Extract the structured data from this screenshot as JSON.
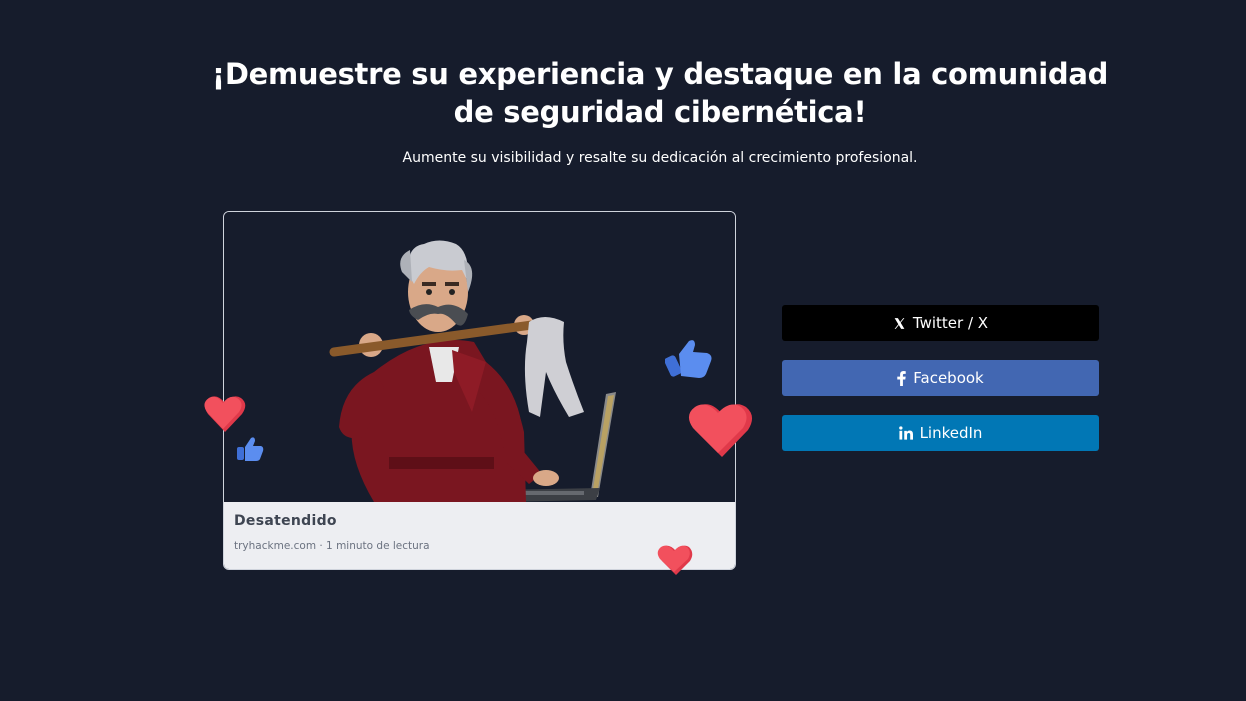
{
  "hero": {
    "headline": "¡Demuestre su experiencia y destaque en la comunidad de seguridad cibernética!",
    "subtitle": "Aumente su visibilidad y resalte su dedicación al crecimiento profesional."
  },
  "card": {
    "title": "Desatendido",
    "meta": "tryhackme.com · 1 minuto de lectura",
    "image_icon": "hacker-character-illustration"
  },
  "share": {
    "twitter_label": "Twitter / X",
    "facebook_label": "Facebook",
    "linkedin_label": "LinkedIn",
    "twitter_icon": "x-logo-icon",
    "facebook_icon": "facebook-icon",
    "linkedin_icon": "linkedin-icon"
  },
  "colors": {
    "background": "#161c2c",
    "twitter": "#000000",
    "facebook": "#4267b2",
    "linkedin": "#0177b5",
    "heart": "#f2505d",
    "thumb": "#5b8def"
  }
}
